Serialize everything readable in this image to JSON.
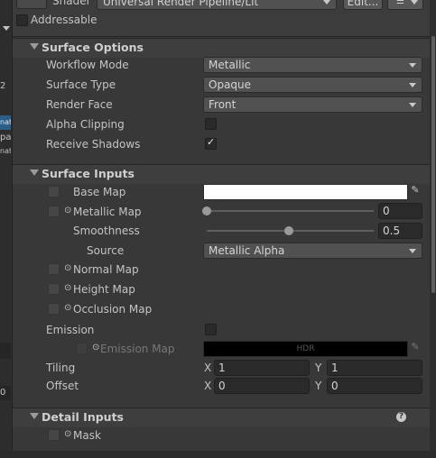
{
  "left_strip": {
    "items": [
      "2",
      "nat",
      "ра",
      "nat",
      "0"
    ]
  },
  "header": {
    "shader_label": "Shader",
    "shader_value": "Universal Render Pipeline/Lit",
    "edit_button": "Edit...",
    "addressable_label": "Addressable"
  },
  "surface_options": {
    "title": "Surface Options",
    "workflow_mode": {
      "label": "Workflow Mode",
      "value": "Metallic"
    },
    "surface_type": {
      "label": "Surface Type",
      "value": "Opaque"
    },
    "render_face": {
      "label": "Render Face",
      "value": "Front"
    },
    "alpha_clipping": {
      "label": "Alpha Clipping",
      "checked": false
    },
    "receive_shadows": {
      "label": "Receive Shadows",
      "checked": true
    }
  },
  "surface_inputs": {
    "title": "Surface Inputs",
    "base_map": {
      "label": "Base Map",
      "color": "#ffffff"
    },
    "metallic_map": {
      "label": "Metallic Map",
      "value": "0",
      "level": 0.0
    },
    "smoothness": {
      "label": "Smoothness",
      "value": "0.5",
      "level": 0.5
    },
    "source": {
      "label": "Source",
      "value": "Metallic Alpha"
    },
    "normal_map": {
      "label": "Normal Map"
    },
    "height_map": {
      "label": "Height Map"
    },
    "occlusion_map": {
      "label": "Occlusion Map"
    },
    "emission": {
      "label": "Emission",
      "checked": false
    },
    "emission_map": {
      "label": "Emission Map",
      "hdr_label": "HDR",
      "color": "#000000"
    },
    "tiling": {
      "label": "Tiling",
      "x_label": "X",
      "x": "1",
      "y_label": "Y",
      "y": "1"
    },
    "offset": {
      "label": "Offset",
      "x_label": "X",
      "x": "0",
      "y_label": "Y",
      "y": "0"
    }
  },
  "detail_inputs": {
    "title": "Detail Inputs",
    "mask": {
      "label": "Mask"
    },
    "help_icon": "help-icon"
  },
  "colors": {
    "panel_bg": "#383838",
    "section_bg": "#3e3e3e",
    "selected_blue": "#2c5d87"
  }
}
